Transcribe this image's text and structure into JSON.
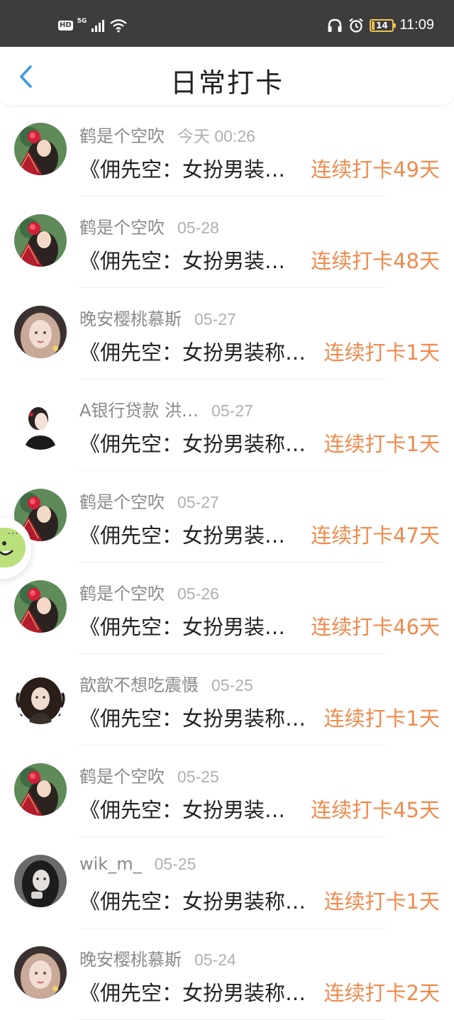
{
  "status_bar": {
    "hd": "HD",
    "network": "5G",
    "battery": "14",
    "time": "11:09",
    "icons": [
      "signal-icon",
      "wifi-icon",
      "headphones-icon",
      "alarm-icon",
      "battery-icon"
    ]
  },
  "header": {
    "title": "日常打卡",
    "back_icon": "chevron-left-icon"
  },
  "colors": {
    "accent_back": "#3a9be8",
    "streak": "#f08a4b",
    "name": "#8a8a8a",
    "date": "#b0b0b0"
  },
  "items": [
    {
      "name": "鹤是个空吹",
      "date": "今天 00:26",
      "text": "《佣先空：女扮男装…",
      "streak": "连续打卡49天",
      "avatar": "flower-girl"
    },
    {
      "name": "鹤是个空吹",
      "date": "05-28",
      "text": "《佣先空：女扮男装…",
      "streak": "连续打卡48天",
      "avatar": "flower-girl"
    },
    {
      "name": "晚安樱桃慕斯",
      "date": "05-27",
      "text": "《佣先空：女扮男装称…",
      "streak": "连续打卡1天",
      "avatar": "pale-girl"
    },
    {
      "name": "A银行贷款 洪…",
      "date": "05-27",
      "text": "《佣先空：女扮男装称…",
      "streak": "连续打卡1天",
      "avatar": "sketch-girl"
    },
    {
      "name": "鹤是个空吹",
      "date": "05-27",
      "text": "《佣先空：女扮男装…",
      "streak": "连续打卡47天",
      "avatar": "flower-girl"
    },
    {
      "name": "鹤是个空吹",
      "date": "05-26",
      "text": "《佣先空：女扮男装…",
      "streak": "连续打卡46天",
      "avatar": "flower-girl"
    },
    {
      "name": "歆歆不想吃震慑",
      "date": "05-25",
      "text": "《佣先空：女扮男装称…",
      "streak": "连续打卡1天",
      "avatar": "curly-girl"
    },
    {
      "name": "鹤是个空吹",
      "date": "05-25",
      "text": "《佣先空：女扮男装…",
      "streak": "连续打卡45天",
      "avatar": "flower-girl"
    },
    {
      "name": "wik_m_",
      "date": "05-25",
      "text": "《佣先空：女扮男装称…",
      "streak": "连续打卡1天",
      "avatar": "dark-girl"
    },
    {
      "name": "晚安樱桃慕斯",
      "date": "05-24",
      "text": "《佣先空：女扮男装称…",
      "streak": "连续打卡2天",
      "avatar": "pale-girl"
    }
  ],
  "float_button": {
    "icon": "emoji-face-icon",
    "dots": "…"
  }
}
